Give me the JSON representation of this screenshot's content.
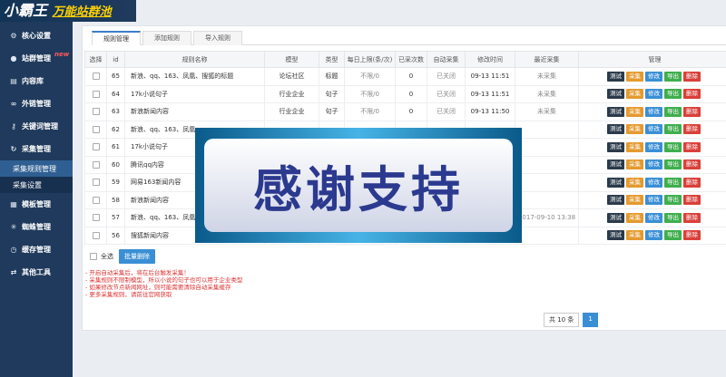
{
  "app": {
    "logo_main": "小霸王",
    "logo_sub": "万能站群池"
  },
  "sidebar": {
    "items": [
      {
        "icon": "gear-icon",
        "label": "核心设置"
      },
      {
        "icon": "user-icon",
        "label": "站群管理",
        "badge": "new"
      },
      {
        "icon": "list-icon",
        "label": "内容库"
      },
      {
        "icon": "link-icon",
        "label": "外链管理"
      },
      {
        "icon": "key-icon",
        "label": "关键词管理"
      },
      {
        "icon": "refresh-icon",
        "label": "采集管理"
      }
    ],
    "sub_items": [
      {
        "label": "采集规则管理",
        "active": true
      },
      {
        "label": "采集设置",
        "active": false
      }
    ],
    "items_after": [
      {
        "icon": "grid-icon",
        "label": "模板管理"
      },
      {
        "icon": "spider-icon",
        "label": "蜘蛛管理"
      },
      {
        "icon": "clock-icon",
        "label": "缓存管理"
      },
      {
        "icon": "shuffle-icon",
        "label": "其他工具"
      }
    ]
  },
  "tabs": [
    {
      "label": "规则管理",
      "active": true
    },
    {
      "label": "添加规则",
      "active": false
    },
    {
      "label": "导入规则",
      "active": false
    }
  ],
  "table": {
    "headers": [
      "选择",
      "id",
      "规则名称",
      "模型",
      "类型",
      "每日上限(条/次)",
      "已采次数",
      "自动采集",
      "修改时间",
      "最近采集",
      "管理"
    ],
    "rows": [
      {
        "id": "65",
        "name": "新浪、qq、163、凤凰、搜狐的标题",
        "model": "论坛社区",
        "type": "标题",
        "limit": "不限/0",
        "count": "0",
        "auto": "已关闭",
        "modified": "09-13 11:51",
        "last": "未采集"
      },
      {
        "id": "64",
        "name": "17k小说句子",
        "model": "行业企业",
        "type": "句子",
        "limit": "不限/0",
        "count": "0",
        "auto": "已关闭",
        "modified": "09-13 11:51",
        "last": "未采集"
      },
      {
        "id": "63",
        "name": "新浪新闻内容",
        "model": "行业企业",
        "type": "句子",
        "limit": "不限/0",
        "count": "0",
        "auto": "已关闭",
        "modified": "09-13 11:50",
        "last": "未采集"
      },
      {
        "id": "62",
        "name": "新浪、qq、163、凤凰...",
        "model": "",
        "type": "",
        "limit": "",
        "count": "",
        "auto": "",
        "modified": "",
        "last": ""
      },
      {
        "id": "61",
        "name": "17k小说句子",
        "model": "",
        "type": "",
        "limit": "",
        "count": "",
        "auto": "",
        "modified": "",
        "last": ""
      },
      {
        "id": "60",
        "name": "腾讯qq内容",
        "model": "",
        "type": "",
        "limit": "",
        "count": "",
        "auto": "",
        "modified": "",
        "last": ""
      },
      {
        "id": "59",
        "name": "网易163新闻内容",
        "model": "",
        "type": "",
        "limit": "",
        "count": "",
        "auto": "",
        "modified": "",
        "last": ""
      },
      {
        "id": "58",
        "name": "新浪新闻内容",
        "model": "",
        "type": "",
        "limit": "",
        "count": "",
        "auto": "",
        "modified": "",
        "last": ""
      },
      {
        "id": "57",
        "name": "新浪、qq、163、凤凰...",
        "model": "",
        "type": "",
        "limit": "",
        "count": "",
        "auto": "",
        "modified": "",
        "last": "2017-09-10 13:38"
      },
      {
        "id": "56",
        "name": "搜狐新闻内容",
        "model": "",
        "type": "",
        "limit": "",
        "count": "",
        "auto": "",
        "modified": "",
        "last": ""
      }
    ],
    "actions": [
      "测试",
      "采集",
      "修改",
      "导出",
      "删除"
    ]
  },
  "bulk": {
    "select_all": "全选",
    "delete": "批量删除"
  },
  "notes": [
    "- 开启自动采集后，将在后台触发采集！",
    "- 采集规则不限制模型，所以小说的句子也可以用于企业类型",
    "- 如果修改节点新闻网址，则可能需要清除自动采集缓存",
    "- 更多采集规则，请前往官网获取"
  ],
  "pager": {
    "total": "共 10 条",
    "page": "1"
  },
  "overlay": {
    "text": "感谢支持"
  }
}
